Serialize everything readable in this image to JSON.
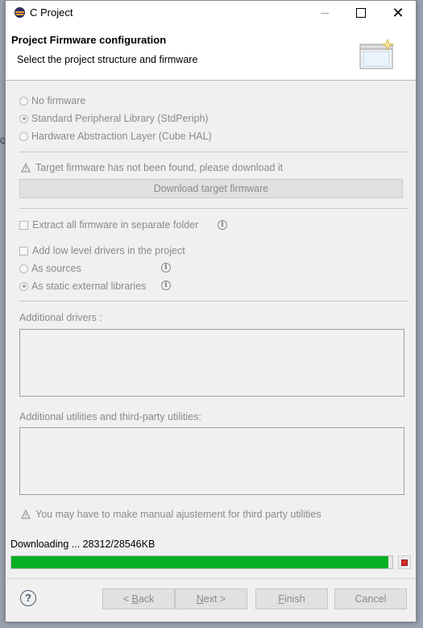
{
  "window": {
    "title": "C Project"
  },
  "header": {
    "title": "Project Firmware configuration",
    "subtitle": "Select the project structure and firmware"
  },
  "firmware_options": [
    {
      "label": "No firmware",
      "selected": false
    },
    {
      "label": "Standard Peripheral Library (StdPeriph)",
      "selected": true
    },
    {
      "label": "Hardware Abstraction Layer (Cube HAL)",
      "selected": false
    }
  ],
  "warning_target": "Target firmware has not been found, please download it",
  "download_button": "Download target firmware",
  "extract_checkbox": {
    "label": "Extract all firmware in separate folder",
    "checked": false
  },
  "low_level": {
    "checkbox_label": "Add low level drivers in the project",
    "checked": false,
    "as_sources": "As sources",
    "as_static": "As static external libraries"
  },
  "additional_drivers_label": "Additional drivers :",
  "additional_utilities_label": "Additional utilities and third-party utilities:",
  "warning_third_party": "You may have to make manual ajustement for third party utilities",
  "progress": {
    "label": "Downloading ... 28312/28546KB",
    "fraction": 0.99
  },
  "buttons": {
    "back_prefix": "< ",
    "back_mnemonic": "B",
    "back_rest": "ack",
    "next_mnemonic": "N",
    "next_rest": "ext >",
    "finish_mnemonic": "F",
    "finish_rest": "inish",
    "cancel": "Cancel"
  },
  "background_fragments": {
    "letter": "G"
  },
  "colors": {
    "progress_green": "#06b025",
    "stop_red": "#d02b2b",
    "disabled_text": "#8a8a8a"
  }
}
